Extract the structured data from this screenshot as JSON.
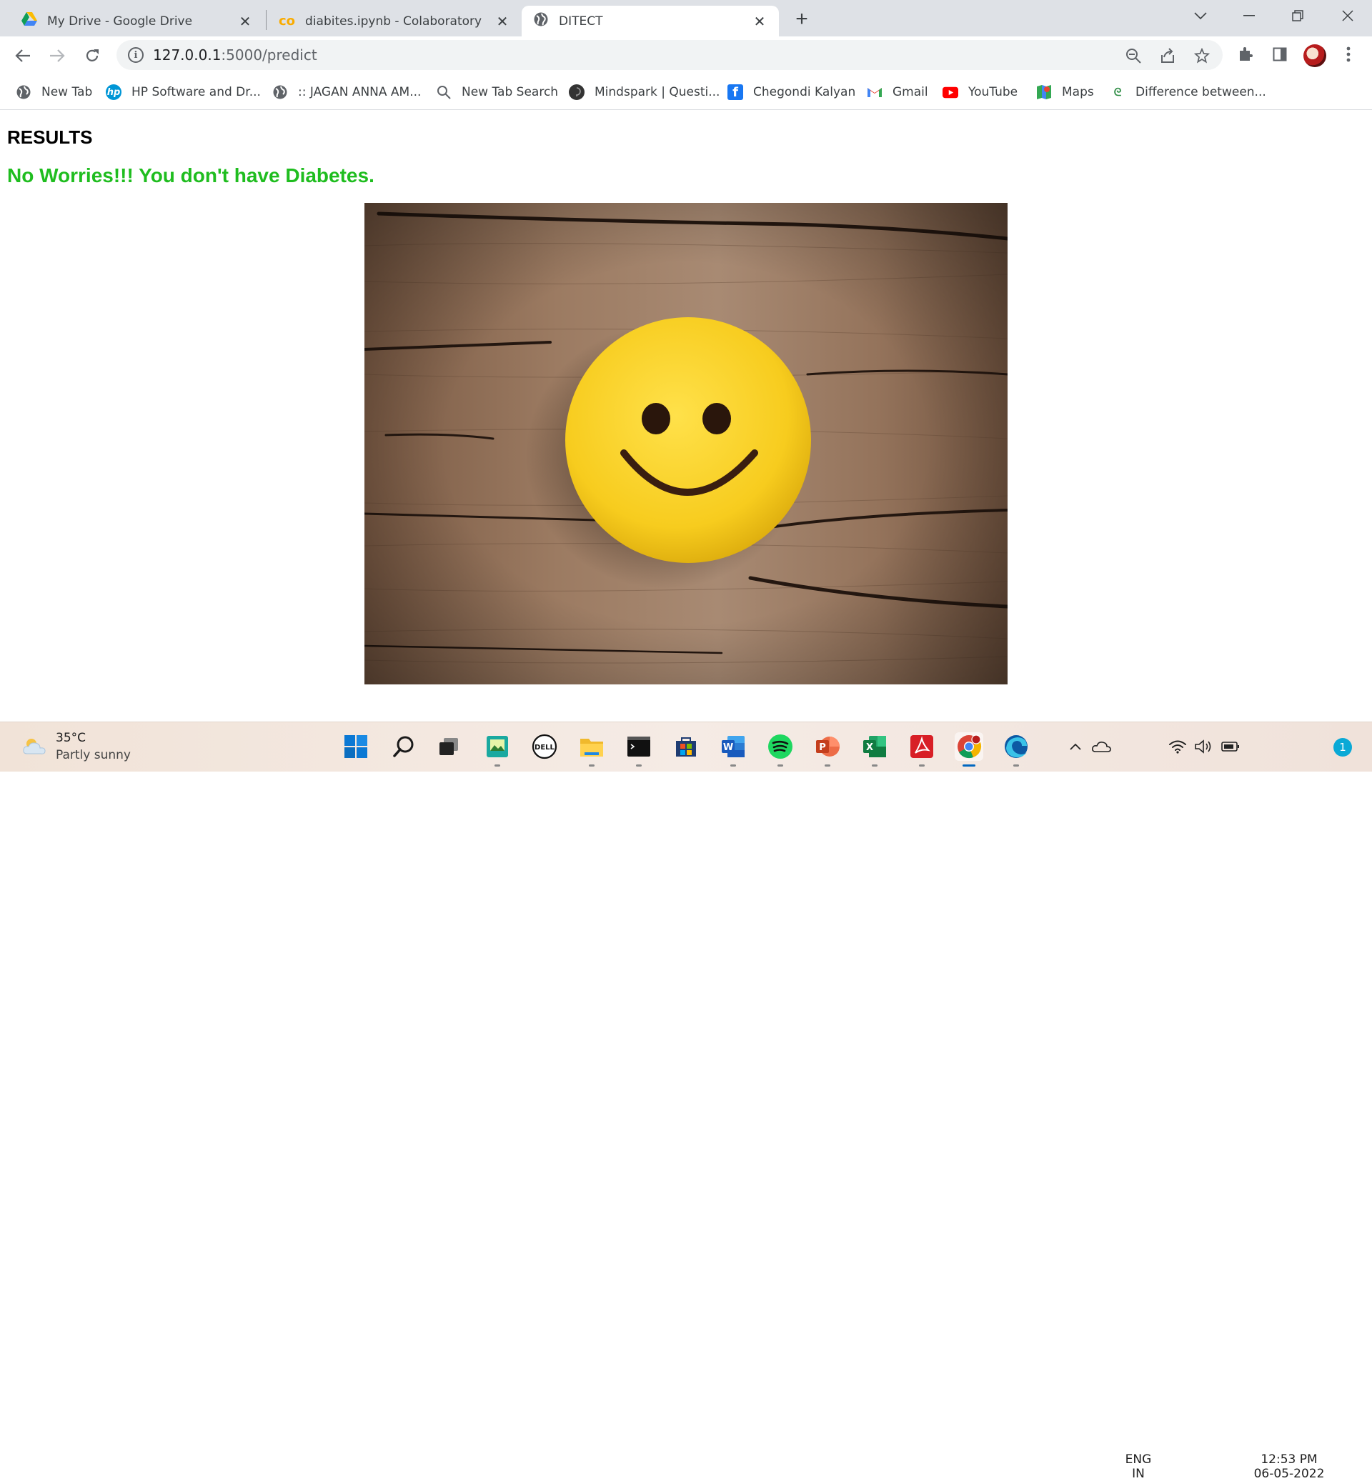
{
  "browser": {
    "tabs": [
      {
        "title": "My Drive - Google Drive",
        "icon": "google-drive-icon"
      },
      {
        "title": "diabites.ipynb - Colaboratory",
        "icon": "colab-icon"
      },
      {
        "title": "DITECT",
        "icon": "globe-icon",
        "active": true
      }
    ],
    "url_host": "127.0.0.1",
    "url_path": ":5000/predict",
    "bookmarks": [
      {
        "label": "New Tab",
        "icon": "globe-icon"
      },
      {
        "label": "HP Software and Dr...",
        "icon": "hp-icon"
      },
      {
        "label": ":: JAGAN ANNA AM...",
        "icon": "globe-icon"
      },
      {
        "label": "New Tab Search",
        "icon": "search-icon"
      },
      {
        "label": "Mindspark | Questi...",
        "icon": "mindspark-icon"
      },
      {
        "label": "Chegondi Kalyan",
        "icon": "facebook-icon"
      },
      {
        "label": "Gmail",
        "icon": "gmail-icon"
      },
      {
        "label": "YouTube",
        "icon": "youtube-icon"
      },
      {
        "label": "Maps",
        "icon": "maps-icon"
      },
      {
        "label": "Difference between...",
        "icon": "geeksforgeeks-icon"
      }
    ]
  },
  "page": {
    "heading": "RESULTS",
    "result": "No Worries!!! You don't have Diabetes.",
    "result_color": "#1fbd1f",
    "image": "smiley-face-cookie-on-wood"
  },
  "taskbar": {
    "weather_temp": "35°C",
    "weather_cond": "Partly sunny",
    "lang_top": "ENG",
    "lang_bottom": "IN",
    "time": "12:53 PM",
    "date": "06-05-2022",
    "notifications": "1"
  }
}
